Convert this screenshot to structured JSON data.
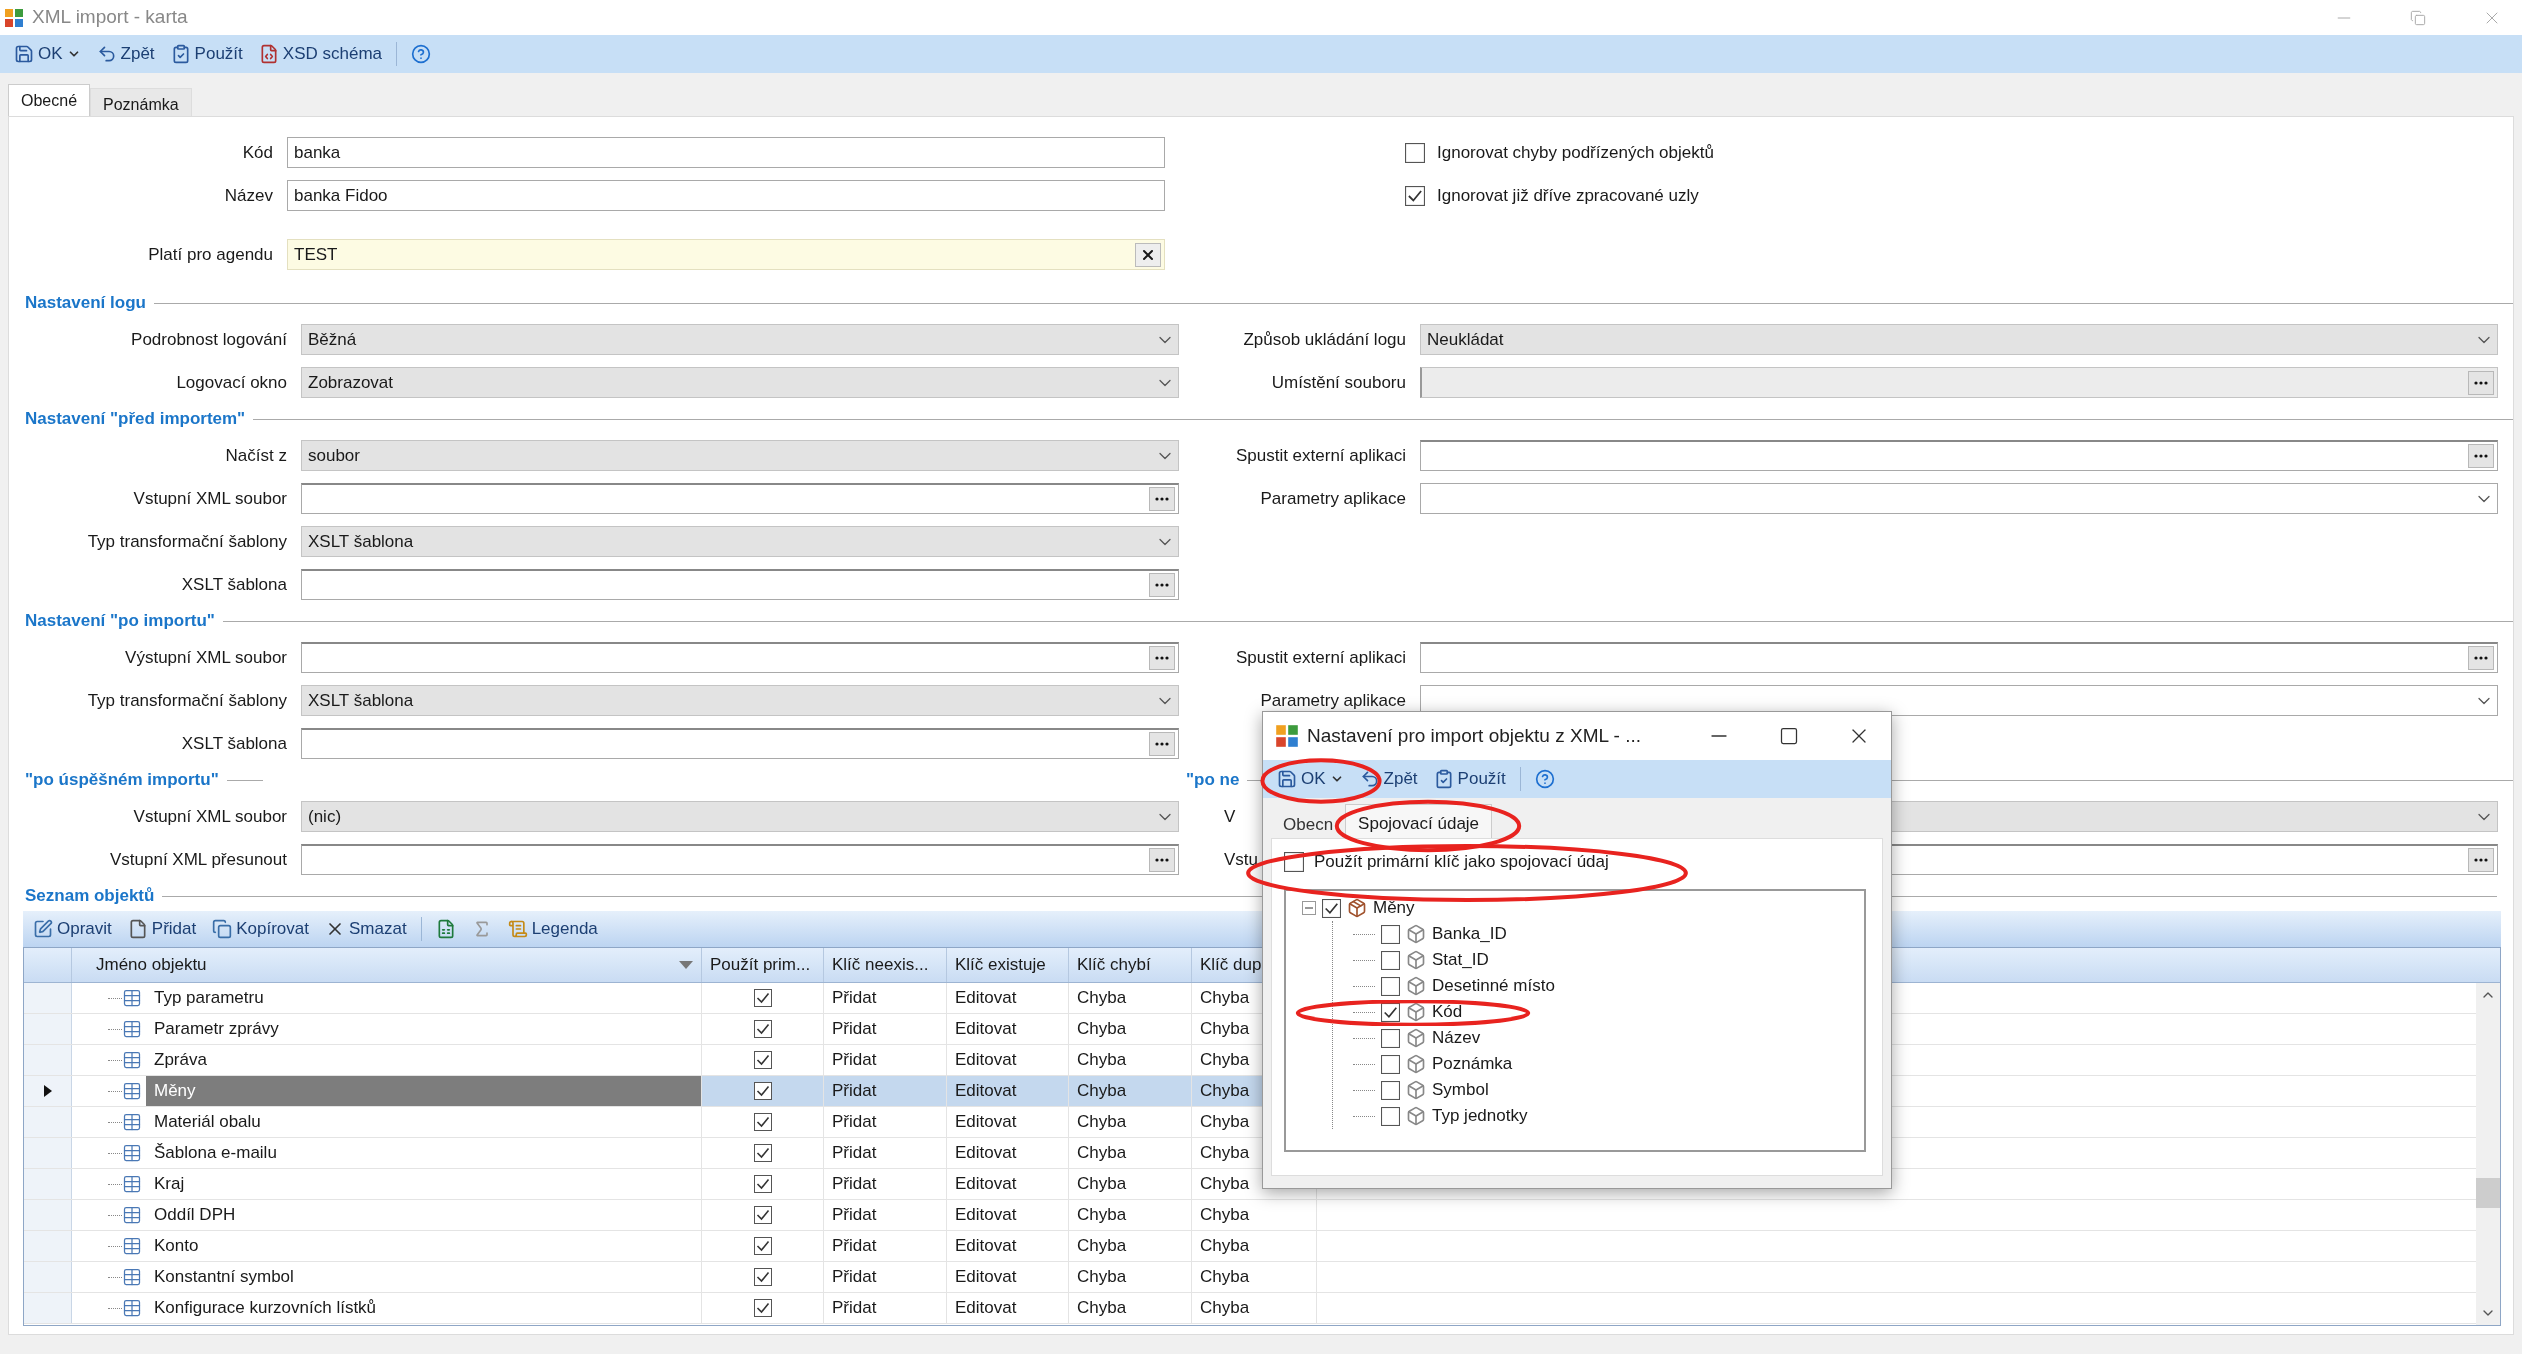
{
  "window": {
    "title": "XML import - karta"
  },
  "toolbar": [
    {
      "label": "OK",
      "kind": "save_menu"
    },
    {
      "label": "Zpět",
      "kind": "undo"
    },
    {
      "label": "Použít",
      "kind": "apply"
    },
    {
      "label": "XSD schéma",
      "kind": "xsd"
    },
    {
      "kind": "help"
    }
  ],
  "tabs": [
    {
      "label": "Obecné",
      "selected": true
    },
    {
      "label": "Poznámka",
      "selected": false
    }
  ],
  "general": {
    "fields": [
      {
        "label": "Kód",
        "kind": "text",
        "value": "banka"
      },
      {
        "label": "Název",
        "kind": "text",
        "value": "banka Fidoo"
      },
      {
        "label": "Platí pro agendu",
        "kind": "lookup",
        "value": "TEST"
      }
    ],
    "options": [
      {
        "label": "Ignorovat chyby podřízených objektů",
        "checked": false
      },
      {
        "label": "Ignorovat již dříve zpracované uzly",
        "checked": true
      }
    ]
  },
  "sections": [
    {
      "title": "Nastavení logu",
      "left": [
        {
          "label": "Podrobnost logování",
          "kind": "combo",
          "value": "Běžná"
        },
        {
          "label": "Logovací okno",
          "kind": "combo",
          "value": "Zobrazovat"
        }
      ],
      "right": [
        {
          "label": "Způsob ukládání logu",
          "kind": "combo",
          "value": "Neukládat"
        },
        {
          "label": "Umístění souboru",
          "kind": "readonly_browse"
        }
      ]
    },
    {
      "title": "Nastavení \"před importem\"",
      "left": [
        {
          "label": "Načíst z",
          "kind": "combo",
          "value": "soubor"
        },
        {
          "label": "Vstupní XML soubor",
          "kind": "browse"
        },
        {
          "label": "Typ transformační šablony",
          "kind": "combo",
          "value": "XSLT šablona"
        },
        {
          "label": "XSLT šablona",
          "kind": "browse"
        }
      ],
      "right": [
        {
          "label": "Spustit externí aplikaci",
          "kind": "browse"
        },
        {
          "label": "Parametry aplikace",
          "kind": "editable_combo"
        }
      ]
    },
    {
      "title": "Nastavení \"po importu\"",
      "left": [
        {
          "label": "Výstupní XML soubor",
          "kind": "browse"
        },
        {
          "label": "Typ transformační šablony",
          "kind": "combo",
          "value": "XSLT šablona"
        },
        {
          "label": "XSLT šablona",
          "kind": "browse"
        }
      ],
      "right": [
        {
          "label": "Spustit externí aplikaci",
          "kind": "browse"
        },
        {
          "label": "Parametry aplikace",
          "kind": "editable_combo"
        }
      ]
    },
    {
      "title": "\"po úspěšném importu\"",
      "right_title": "\"po ne",
      "left": [
        {
          "label": "Vstupní XML soubor",
          "kind": "combo",
          "value": "(nic)"
        },
        {
          "label": "Vstupní XML přesunout",
          "kind": "browse"
        }
      ],
      "right": [
        {
          "label": "V",
          "kind": "combo"
        },
        {
          "label": "Vstu",
          "kind": "browse"
        }
      ]
    }
  ],
  "objects": {
    "title": "Seznam objektů",
    "toolbar": [
      {
        "label": "Opravit",
        "kind": "edit"
      },
      {
        "label": "Přidat",
        "kind": "add"
      },
      {
        "label": "Kopírovat",
        "kind": "copy"
      },
      {
        "label": "Smazat",
        "kind": "delete"
      },
      {
        "kind": "excel"
      },
      {
        "kind": "sum"
      },
      {
        "label": "Legenda",
        "kind": "legend"
      }
    ],
    "columns": [
      "Jméno objektu",
      "Použít prim...",
      "Klíč neexis...",
      "Klíč existuje",
      "Klíč chybí",
      "Klíč dup"
    ],
    "rows": [
      {
        "cells": [
          "Typ parametru",
          {
            "checked": true
          },
          "Přidat",
          "Editovat",
          "Chyba",
          "Chyba"
        ],
        "selected": false
      },
      {
        "cells": [
          "Parametr zprávy",
          {
            "checked": true
          },
          "Přidat",
          "Editovat",
          "Chyba",
          "Chyba"
        ],
        "selected": false
      },
      {
        "cells": [
          "Zpráva",
          {
            "checked": true
          },
          "Přidat",
          "Editovat",
          "Chyba",
          "Chyba"
        ],
        "selected": false
      },
      {
        "cells": [
          "Měny",
          {
            "checked": true
          },
          "Přidat",
          "Editovat",
          "Chyba",
          "Chyba"
        ],
        "selected": true
      },
      {
        "cells": [
          "Materiál obalu",
          {
            "checked": true
          },
          "Přidat",
          "Editovat",
          "Chyba",
          "Chyba"
        ],
        "selected": false
      },
      {
        "cells": [
          "Šablona e-mailu",
          {
            "checked": true
          },
          "Přidat",
          "Editovat",
          "Chyba",
          "Chyba"
        ],
        "selected": false
      },
      {
        "cells": [
          "Kraj",
          {
            "checked": true
          },
          "Přidat",
          "Editovat",
          "Chyba",
          "Chyba"
        ],
        "selected": false
      },
      {
        "cells": [
          "Oddíl DPH",
          {
            "checked": true
          },
          "Přidat",
          "Editovat",
          "Chyba",
          "Chyba"
        ],
        "selected": false
      },
      {
        "cells": [
          "Konto",
          {
            "checked": true
          },
          "Přidat",
          "Editovat",
          "Chyba",
          "Chyba"
        ],
        "selected": false
      },
      {
        "cells": [
          "Konstantní symbol",
          {
            "checked": true
          },
          "Přidat",
          "Editovat",
          "Chyba",
          "Chyba"
        ],
        "selected": false
      },
      {
        "cells": [
          "Konfigurace kurzovních lístků",
          {
            "checked": true
          },
          "Přidat",
          "Editovat",
          "Chyba",
          "Chyba"
        ],
        "selected": false
      }
    ]
  },
  "dialog": {
    "title": "Nastavení pro import objektu z XML - ...",
    "toolbar": [
      {
        "label": "OK",
        "kind": "save_menu"
      },
      {
        "label": "Zpět",
        "kind": "undo"
      },
      {
        "label": "Použít",
        "kind": "apply"
      },
      {
        "kind": "help"
      }
    ],
    "tabs": [
      {
        "label": "Obecn",
        "selected": false
      },
      {
        "label": "Spojovací údaje",
        "selected": true
      }
    ],
    "option": {
      "label": "Použít primární klíč jako spojovací údaj",
      "checked": false
    },
    "tree": {
      "label": "Měny",
      "checked": true,
      "expanded": true,
      "children": [
        {
          "label": "Banka_ID",
          "checked": false
        },
        {
          "label": "Stat_ID",
          "checked": false
        },
        {
          "label": "Desetinné místo",
          "checked": false
        },
        {
          "label": "Kód",
          "checked": true
        },
        {
          "label": "Název",
          "checked": false
        },
        {
          "label": "Poznámka",
          "checked": false
        },
        {
          "label": "Symbol",
          "checked": false
        },
        {
          "label": "Typ jednotky",
          "checked": false
        }
      ]
    }
  }
}
